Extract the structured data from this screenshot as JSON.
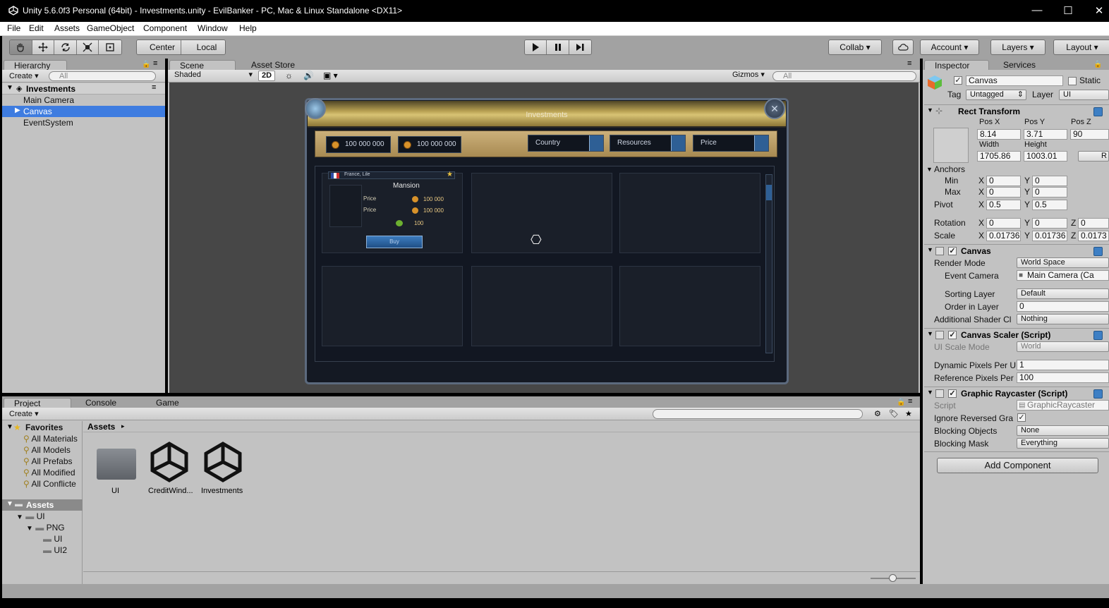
{
  "window": {
    "title": "Unity 5.6.0f3 Personal (64bit) - Investments.unity - EvilBanker - PC, Mac & Linux Standalone <DX11>",
    "minimize": "—",
    "maximize": "☐",
    "close": "✕"
  },
  "menu": [
    "File",
    "Edit",
    "Assets",
    "GameObject",
    "Component",
    "Window",
    "Help"
  ],
  "toolbar": {
    "pivot_center": "Center",
    "pivot_local": "Local",
    "collab": "Collab",
    "account": "Account",
    "layers": "Layers",
    "layout": "Layout"
  },
  "hierarchy": {
    "tab": "Hierarchy",
    "create": "Create",
    "search_placeholder": "All",
    "scene_name": "Investments",
    "items": [
      "Main Camera",
      "Canvas",
      "EventSystem"
    ],
    "selected": "Canvas"
  },
  "scene": {
    "tab_scene": "Scene",
    "tab_asset_store": "Asset Store",
    "shading": "Shaded",
    "mode_2d": "2D",
    "gizmos": "Gizmos",
    "search_placeholder": "All"
  },
  "game_ui": {
    "window_title": "Investments",
    "currency1": "100 000 000",
    "currency2": "100 000 000",
    "filter_country": "Country",
    "filter_resources": "Resources",
    "filter_price": "Price",
    "card": {
      "location": "France, Lile",
      "name": "Mansion",
      "price_label_1": "Price",
      "price_value_1": "100 000",
      "price_label_2": "Price",
      "price_value_2": "100 000",
      "income": "100",
      "buy": "Buy"
    }
  },
  "project": {
    "tab_project": "Project",
    "tab_console": "Console",
    "tab_game": "Game",
    "create": "Create",
    "favorites_label": "Favorites",
    "favorites": [
      "All Materials",
      "All Models",
      "All Prefabs",
      "All Modified",
      "All Conflicte"
    ],
    "assets_label": "Assets",
    "tree": [
      "UI",
      "PNG",
      "UI",
      "UI2"
    ],
    "breadcrumb": "Assets",
    "files": [
      "UI",
      "CreditWind...",
      "Investments"
    ]
  },
  "inspector": {
    "tab_inspector": "Inspector",
    "tab_services": "Services",
    "object_name": "Canvas",
    "static_label": "Static",
    "tag_label": "Tag",
    "tag_value": "Untagged",
    "layer_label": "Layer",
    "layer_value": "UI",
    "rect_transform": {
      "title": "Rect Transform",
      "pos_x_label": "Pos X",
      "pos_y_label": "Pos Y",
      "pos_z_label": "Pos Z",
      "pos_x": "8.14",
      "pos_y": "3.71",
      "pos_z": "90",
      "width_label": "Width",
      "height_label": "Height",
      "width": "1705.86",
      "height": "1003.01",
      "anchors_label": "Anchors",
      "min_label": "Min",
      "max_label": "Max",
      "min_x": "0",
      "min_y": "0",
      "max_x": "0",
      "max_y": "0",
      "pivot_label": "Pivot",
      "pivot_x": "0.5",
      "pivot_y": "0.5",
      "rotation_label": "Rotation",
      "rot_x": "0",
      "rot_y": "0",
      "rot_z": "0",
      "scale_label": "Scale",
      "scale_x": "0.01736",
      "scale_y": "0.01736",
      "scale_z": "0.0173",
      "x": "X",
      "y": "Y",
      "z": "Z",
      "r_btn": "R"
    },
    "canvas": {
      "title": "Canvas",
      "render_mode_label": "Render Mode",
      "render_mode": "World Space",
      "event_camera_label": "Event Camera",
      "event_camera": "Main Camera (Ca",
      "sorting_layer_label": "Sorting Layer",
      "sorting_layer": "Default",
      "order_label": "Order in Layer",
      "order": "0",
      "shader_label": "Additional Shader Cl",
      "shader": "Nothing"
    },
    "scaler": {
      "title": "Canvas Scaler (Script)",
      "ui_scale_label": "UI Scale Mode",
      "ui_scale": "World",
      "dpu_label": "Dynamic Pixels Per U",
      "dpu": "1",
      "ref_label": "Reference Pixels Per",
      "ref": "100"
    },
    "raycaster": {
      "title": "Graphic Raycaster (Script)",
      "script_label": "Script",
      "script": "GraphicRaycaster",
      "ignore_label": "Ignore Reversed Gra",
      "blocking_objects_label": "Blocking Objects",
      "blocking_objects": "None",
      "blocking_mask_label": "Blocking Mask",
      "blocking_mask": "Everything"
    },
    "add_component": "Add Component"
  },
  "colors": {
    "selection": "#3e7ce0",
    "panel": "#c2c2c2",
    "toolbar": "#a2a2a2",
    "scene_bg": "#474747"
  }
}
